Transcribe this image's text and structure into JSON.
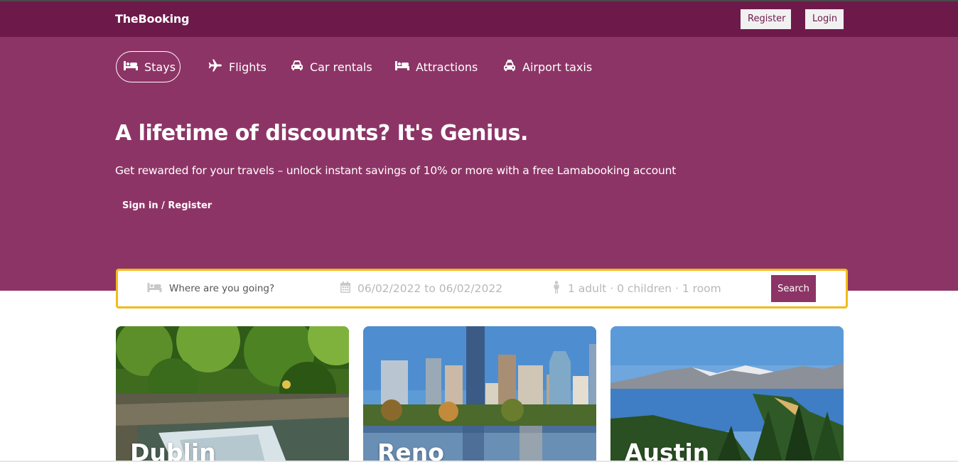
{
  "header": {
    "logo": "TheBooking",
    "register_label": "Register",
    "login_label": "Login"
  },
  "nav": {
    "tabs": [
      {
        "label": "Stays",
        "icon": "bed-icon",
        "active": true
      },
      {
        "label": "Flights",
        "icon": "plane-icon",
        "active": false
      },
      {
        "label": "Car rentals",
        "icon": "car-icon",
        "active": false
      },
      {
        "label": "Attractions",
        "icon": "bed-icon",
        "active": false
      },
      {
        "label": "Airport taxis",
        "icon": "taxi-icon",
        "active": false
      }
    ]
  },
  "hero": {
    "title": "A lifetime of discounts? It's Genius.",
    "subtitle": "Get rewarded for your travels – unlock instant savings of 10% or more with a free Lamabooking account",
    "signin_label": "Sign in / Register"
  },
  "search": {
    "destination_placeholder": "Where are you going?",
    "date_range": "06/02/2022 to 06/02/2022",
    "guests": "1 adult · 0 children · 1 room",
    "button_label": "Search"
  },
  "cards": [
    {
      "city": "Dublin"
    },
    {
      "city": "Reno"
    },
    {
      "city": "Austin"
    }
  ],
  "colors": {
    "header_bg": "#6d1a4b",
    "hero_bg": "#8d3466",
    "search_border": "#f3bb1a",
    "search_button": "#8d3466"
  }
}
